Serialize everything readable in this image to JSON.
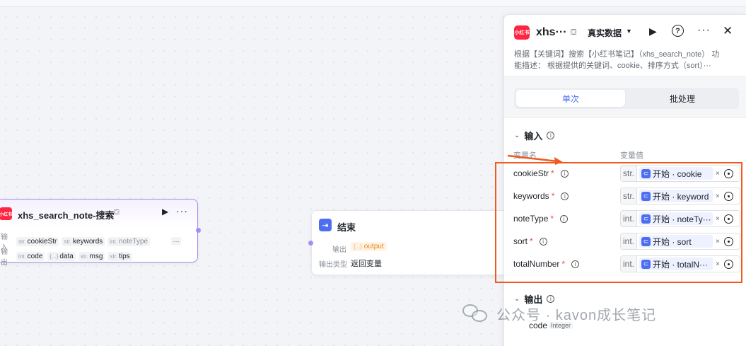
{
  "search_node": {
    "logo_text": "小红书",
    "title": "xhs_search_note-搜索",
    "title_icon": "⛋",
    "run_icon": "▶",
    "more_icon": "···",
    "input_label": "输入",
    "inputs": [
      {
        "type": "str.",
        "name": "cookieStr"
      },
      {
        "type": "str.",
        "name": "keywords"
      },
      {
        "type": "int.",
        "name": "noteType"
      }
    ],
    "inputs_more": "···",
    "output_label": "输出",
    "outputs": [
      {
        "type": "int.",
        "name": "code"
      },
      {
        "type": "{...}",
        "name": "data"
      },
      {
        "type": "str.",
        "name": "msg"
      },
      {
        "type": "str.",
        "name": "tips"
      }
    ]
  },
  "end_node": {
    "icon": "⇥",
    "title": "结束",
    "output_label": "输出",
    "output_type": "{...}",
    "output_name": "output",
    "output_kind_label": "输出类型",
    "output_kind_value": "返回变量"
  },
  "panel": {
    "logo_text": "小红书",
    "title": "xhs···",
    "title_icon": "⛋",
    "mode": "真实数据",
    "mode_caret": "▼",
    "run_icon": "▶",
    "help_icon": "?",
    "more_icon": "···",
    "close_icon": "✕",
    "desc_line1": "根据【关键词】搜索【小红书笔记】（xhs_search_note） 功",
    "desc_line2": "能描述： 根据提供的关键词、cookie、排序方式（sort）···",
    "tabs": [
      "单次",
      "批处理"
    ],
    "input_section": "输入",
    "col_name": "变量名",
    "col_value": "变量值",
    "params": [
      {
        "name": "cookieStr",
        "required": "*",
        "type": "str.",
        "ref": "开始 · cookie"
      },
      {
        "name": "keywords",
        "required": "*",
        "type": "str.",
        "ref": "开始 · keyword"
      },
      {
        "name": "noteType",
        "required": "*",
        "type": "int.",
        "ref": "开始 · noteTy···"
      },
      {
        "name": "sort",
        "required": "*",
        "type": "int.",
        "ref": "开始 · sort"
      },
      {
        "name": "totalNumber",
        "required": "*",
        "type": "int.",
        "ref": "开始 · totalN···"
      }
    ],
    "clear_icon": "×",
    "output_section": "输出",
    "output_item": {
      "name": "code",
      "type": "Integer"
    }
  },
  "watermark": {
    "text": "公众号 · kavon成长笔记"
  },
  "colors": {
    "accent": "#4e6ef2",
    "highlight": "#f05a1e",
    "node_border": "#a78bfa",
    "brand": "#ff2442"
  }
}
